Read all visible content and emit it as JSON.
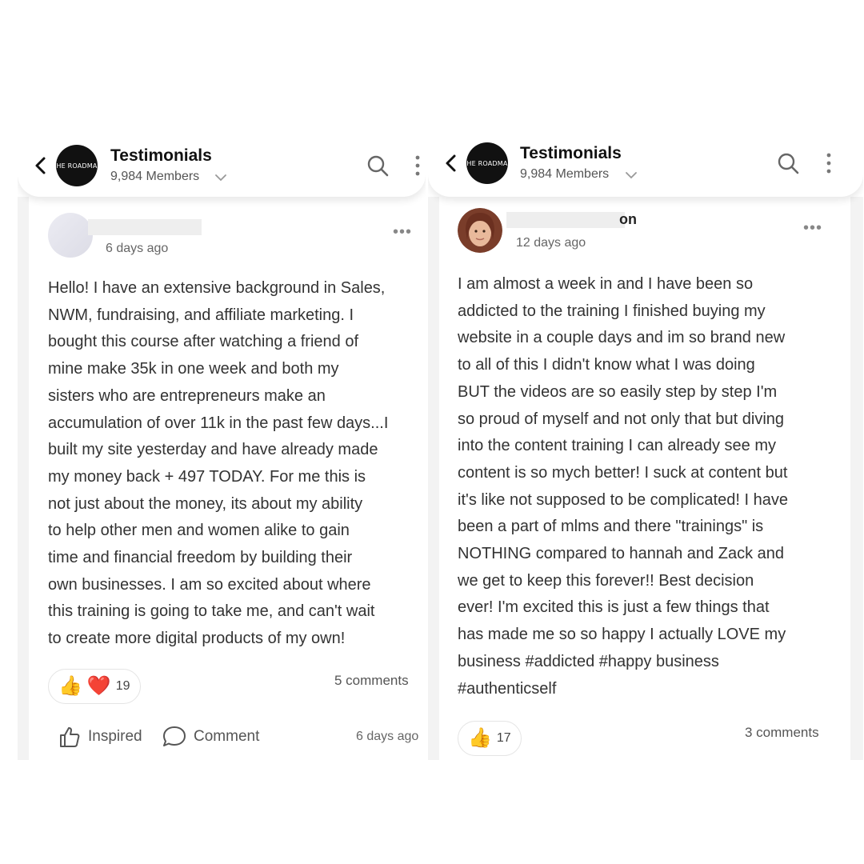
{
  "left": {
    "header": {
      "title": "Testimonials",
      "members": "9,984 Members",
      "logo_text": "HE ROADMA"
    },
    "post": {
      "name_fragment": "",
      "time": "6 days ago",
      "lines": [
        "Hello! I have an extensive background in Sales,",
        "NWM, fundraising, and affiliate marketing. I",
        "bought this course after watching a friend of",
        "mine make 35k in one week and both my",
        "sisters who are entrepreneurs make an",
        "accumulation of over 11k in the past few days...I",
        "built my site yesterday and have already made",
        "my money back + 497 TODAY. For me this is",
        "not just about the money, its about my ability",
        "to help other men and women alike to gain",
        "time and financial freedom by building their",
        "own businesses. I am so excited about where",
        "this training is going to take me, and can't wait",
        "to create more digital products of my own!"
      ],
      "reactions": {
        "emoji_1": "👍",
        "emoji_2": "❤️",
        "count": "19"
      },
      "comments": "5 comments",
      "actions": {
        "inspired": "Inspired",
        "comment": "Comment",
        "time": "6 days ago"
      }
    }
  },
  "right": {
    "header": {
      "title": "Testimonials",
      "members": "9,984 Members",
      "logo_text": "HE ROADMA"
    },
    "post": {
      "name_fragment": "on",
      "time": "12 days ago",
      "lines": [
        "I am almost a week in and I have been so",
        "addicted to the training I finished buying my",
        "website in a couple days and im so brand new",
        "to all of this I didn't know what I was doing",
        "BUT the videos are so easily step by step I'm",
        "so proud of myself and not only that but diving",
        "into the content training I can already see my",
        "content is so mych better! I suck at content but",
        "it's like not supposed to be complicated! I have",
        "been a part of mlms and there \"trainings\" is",
        "NOTHING compared to hannah and Zack and",
        "we get to keep this forever!! Best decision",
        "ever! I'm excited this is just a few things that",
        "has made me so so happy I actually LOVE my",
        "business #addicted #happy business",
        "#authenticself"
      ],
      "reactions": {
        "emoji_1": "👍",
        "count": "17"
      },
      "comments": "3 comments"
    }
  },
  "colors": {
    "header_bg": "#ffffff",
    "text": "#333333",
    "muted": "#666666",
    "heart": "#e0241c",
    "thumb": "#f5b400"
  },
  "icons": [
    "back-arrow-icon",
    "search-icon",
    "more-vertical-icon",
    "chevron-down-icon",
    "more-horizontal-icon",
    "thumbs-up-icon",
    "comment-bubble-icon"
  ]
}
